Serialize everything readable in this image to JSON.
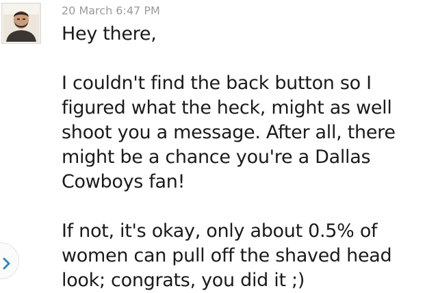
{
  "message": {
    "timestamp": "20 March 6:47 PM",
    "paragraphs": [
      "Hey there,",
      "I couldn't find the back button so I figured what the heck, might as well shoot you a message. After all, there might be a chance you're a Dallas Cowboys fan!",
      "If not, it's okay, only about 0.5% of women can pull off the shaved head look; congrats, you did it ;)"
    ]
  },
  "colors": {
    "accent": "#2a8ab8",
    "timestamp": "#9a9a9a",
    "text": "#1a1a1a"
  },
  "icons": {
    "expand": "chevron-right-icon"
  }
}
